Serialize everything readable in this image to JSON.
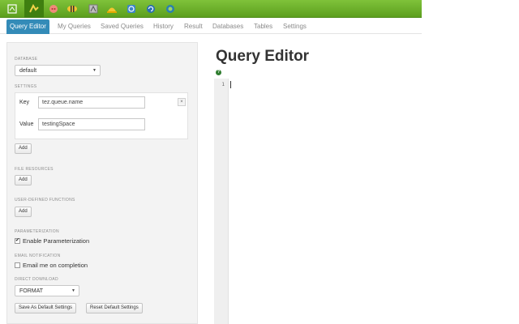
{
  "app_icons": [
    {
      "name": "home-icon",
      "color": "#3f7f10"
    },
    {
      "name": "query-editor-app-icon",
      "color": "#f2d24a",
      "active": true
    },
    {
      "name": "pig-icon",
      "color": "#f08a7a"
    },
    {
      "name": "hive-bee-icon",
      "color": "#f1c232"
    },
    {
      "name": "file-browser-icon",
      "color": "#a0a0a0"
    },
    {
      "name": "hard-hat-icon",
      "color": "#f4c430"
    },
    {
      "name": "oozie-icon",
      "color": "#3d85c6"
    },
    {
      "name": "refresh-icon",
      "color": "#2a6fb0"
    },
    {
      "name": "help-app-icon",
      "color": "#2a7fb0"
    }
  ],
  "tabs": [
    {
      "label": "Query Editor",
      "active": true
    },
    {
      "label": "My Queries"
    },
    {
      "label": "Saved Queries"
    },
    {
      "label": "History"
    },
    {
      "label": "Result"
    },
    {
      "label": "Databases"
    },
    {
      "label": "Tables"
    },
    {
      "label": "Settings"
    }
  ],
  "panel": {
    "database_label": "DATABASE",
    "database_value": "default",
    "settings_label": "SETTINGS",
    "key_label": "Key",
    "key_value": "tez.queue.name",
    "value_label": "Value",
    "value_value": "testingSpace",
    "remove_glyph": "×",
    "add_label": "Add",
    "file_resources_label": "FILE RESOURCES",
    "udf_label": "USER-DEFINED FUNCTIONS",
    "parameterization_label": "PARAMETERIZATION",
    "enable_param_label": "Enable Parameterization",
    "enable_param_checked": true,
    "email_label": "EMAIL NOTIFICATION",
    "email_me_label": "Email me on completion",
    "email_me_checked": false,
    "direct_download_label": "DIRECT DOWNLOAD",
    "format_value": "FORMAT",
    "save_default_label": "Save As Default Settings",
    "reset_default_label": "Reset Default Settings"
  },
  "editor": {
    "title": "Query Editor",
    "help_glyph": "?",
    "line_number": "1"
  },
  "colors": {
    "appbar": "#6db02a",
    "active_tab": "#338bb8",
    "panel_bg": "#f3f3f3"
  }
}
